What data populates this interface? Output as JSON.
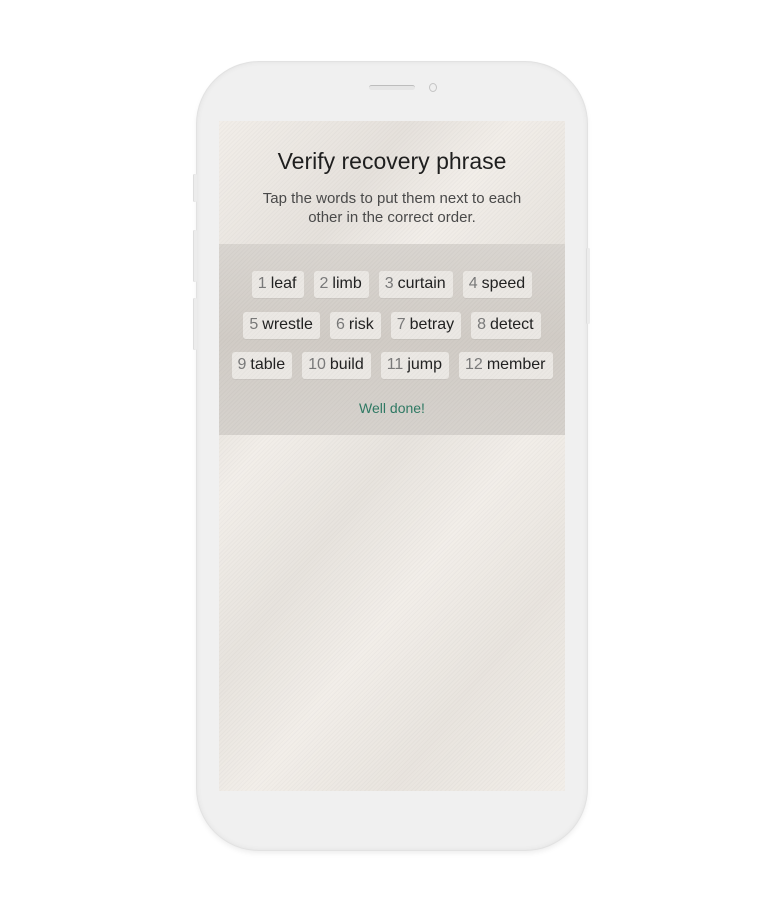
{
  "screen": {
    "title": "Verify recovery phrase",
    "subtitle": "Tap the words to put them next to each other in the correct order.",
    "words": [
      {
        "index": "1",
        "word": "leaf"
      },
      {
        "index": "2",
        "word": "limb"
      },
      {
        "index": "3",
        "word": "curtain"
      },
      {
        "index": "4",
        "word": "speed"
      },
      {
        "index": "5",
        "word": "wrestle"
      },
      {
        "index": "6",
        "word": "risk"
      },
      {
        "index": "7",
        "word": "betray"
      },
      {
        "index": "8",
        "word": "detect"
      },
      {
        "index": "9",
        "word": "table"
      },
      {
        "index": "10",
        "word": "build"
      },
      {
        "index": "11",
        "word": "jump"
      },
      {
        "index": "12",
        "word": "member"
      }
    ],
    "status_message": "Well done!",
    "status_color": "#2f7a64"
  }
}
